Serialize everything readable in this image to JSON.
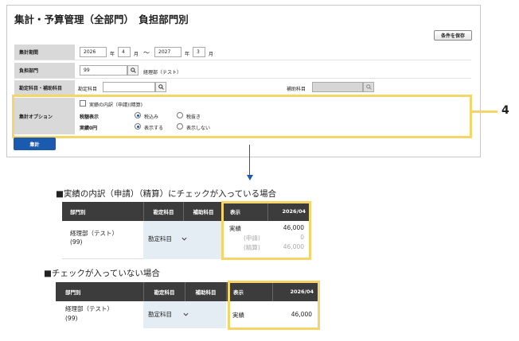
{
  "panel": {
    "title": "集計・予算管理（全部門）　負担部門別",
    "save_button": "条件を保存",
    "period": {
      "label": "集計期間",
      "from_year": "2026",
      "from_year_unit": "年",
      "from_month": "4",
      "from_month_unit": "月",
      "tilde": "〜",
      "to_year": "2027",
      "to_year_unit": "年",
      "to_month": "3",
      "to_month_unit": "月"
    },
    "department": {
      "label": "負担部門",
      "value": "99",
      "name": "経理部（テスト）"
    },
    "account": {
      "label": "勘定科目・補助科目",
      "account_label": "勘定科目",
      "sub_label": "補助科目"
    },
    "options": {
      "label": "集計オプション",
      "detail_checkbox_label": "実績の内訳（申請)(精算)",
      "tax_label": "税額表示",
      "tax_include": "税込み",
      "tax_exclude": "税抜き",
      "zero_label": "実績0円",
      "zero_show": "表示する",
      "zero_hide": "表示しない"
    },
    "submit_button": "集計"
  },
  "callout": {
    "number": "4"
  },
  "checked_case": {
    "heading": "■実績の内訳（申請）（精算）にチェックが入っている場合",
    "headers": {
      "dept": "部門別",
      "account": "勘定科目",
      "sub": "補助科目",
      "display": "表示",
      "period": "2026/04"
    },
    "dept_name": "経理部（テスト）",
    "dept_code": "(99)",
    "account_dropdown": "勘定科目",
    "rows": [
      {
        "label": "実績",
        "value": "46,000"
      },
      {
        "label": "(申請)",
        "value": "0"
      },
      {
        "label": "(精算)",
        "value": "46,000"
      }
    ]
  },
  "unchecked_case": {
    "heading": "■チェックが入っていない場合",
    "headers": {
      "dept": "部門別",
      "account": "勘定科目",
      "sub": "補助科目",
      "display": "表示",
      "period": "2026/04"
    },
    "dept_name": "経理部（テスト）",
    "dept_code": "(99)",
    "account_dropdown": "勘定科目",
    "rows": [
      {
        "label": "実績",
        "value": "46,000"
      }
    ]
  },
  "colors": {
    "accent": "#1a5bb0",
    "highlight": "#f5d56a",
    "header": "#3c3c3c"
  }
}
